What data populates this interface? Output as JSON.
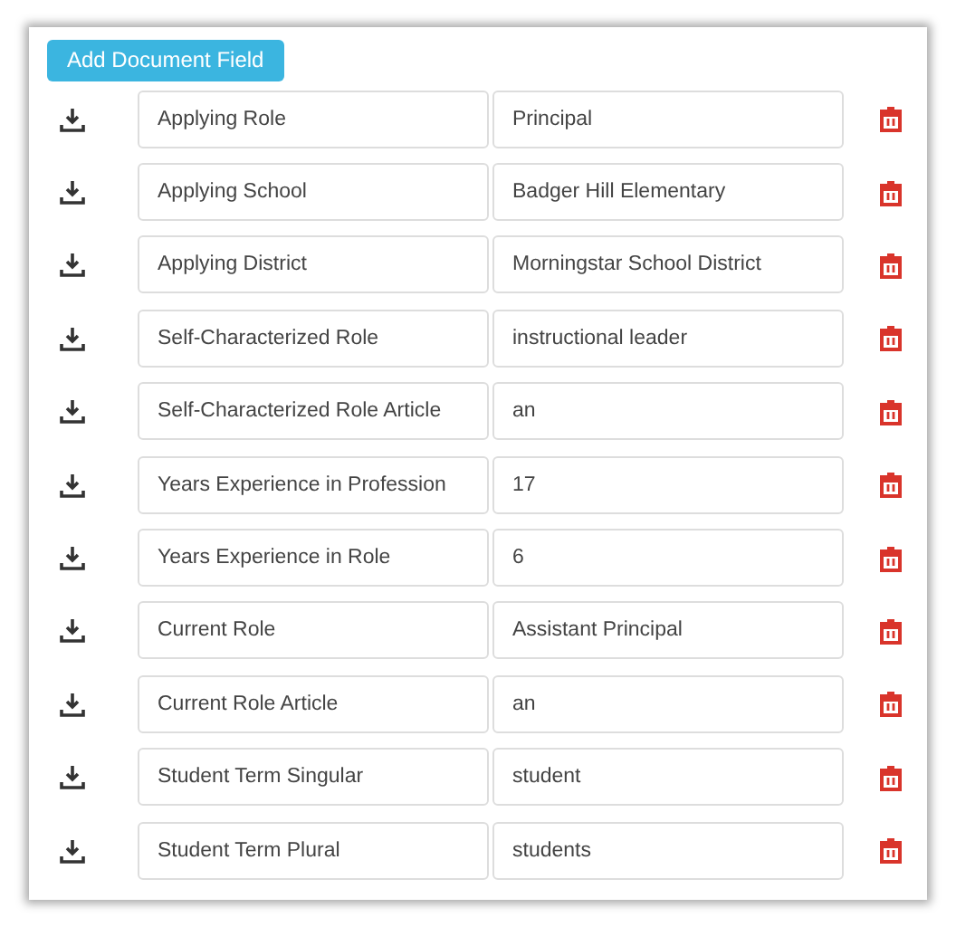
{
  "add_button": {
    "label": "Add Document Field"
  },
  "fields": [
    {
      "name": "Applying Role",
      "value": "Principal"
    },
    {
      "name": "Applying School",
      "value": "Badger Hill Elementary"
    },
    {
      "name": "Applying District",
      "value": "Morningstar School District"
    },
    {
      "name": "Self-Characterized Role",
      "value": "instructional leader"
    },
    {
      "name": "Self-Characterized Role Article",
      "value": "an"
    },
    {
      "name": "Years Experience in Profession",
      "value": "17"
    },
    {
      "name": "Years Experience in Role",
      "value": "6"
    },
    {
      "name": "Current Role",
      "value": "Assistant Principal"
    },
    {
      "name": "Current Role Article",
      "value": "an"
    },
    {
      "name": "Student Term Singular",
      "value": "student"
    },
    {
      "name": "Student Term Plural",
      "value": "students"
    }
  ]
}
